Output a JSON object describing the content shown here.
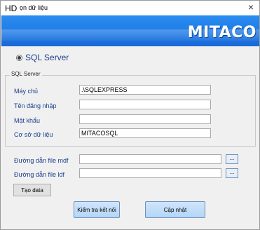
{
  "window": {
    "icon_text": "HD",
    "title": "ọn dữ liệu",
    "close_glyph": "×"
  },
  "banner": {
    "logo_text": "MITACO"
  },
  "server_option": {
    "label": "SQL Server",
    "selected": true
  },
  "sql_group": {
    "legend": "SQL Server",
    "fields": {
      "server": {
        "label": "Máy chủ",
        "value": ".\\SQLEXPRESS"
      },
      "username": {
        "label": "Tên đăng nhập",
        "value": ""
      },
      "password": {
        "label": "Mật khẩu",
        "value": ""
      },
      "database": {
        "label": "Cơ sở dữ liệu",
        "value": "MITACOSQL"
      }
    }
  },
  "files": {
    "mdf": {
      "label": "Đường dẫn file mdf",
      "value": "",
      "browse": "..."
    },
    "ldf": {
      "label": "Đường dẫn file ldf",
      "value": "",
      "browse": "..."
    }
  },
  "buttons": {
    "create_data": "Tạo data",
    "test_connection": "Kiểm tra kết nối",
    "update": "Cập nhật"
  }
}
